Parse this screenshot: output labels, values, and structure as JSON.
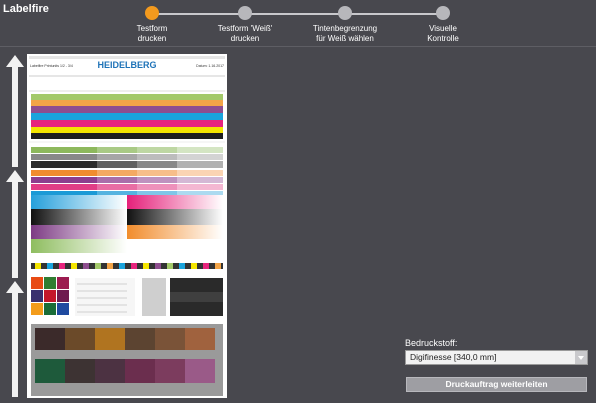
{
  "app": {
    "title": "Labelfire"
  },
  "stepper": {
    "steps": [
      {
        "label": "Testform\ndrucken",
        "state": "active"
      },
      {
        "label": "Testform 'Weiß'\ndrucken",
        "state": "inactive"
      },
      {
        "label": "Tintenbegrenzung\nfür Weiß wählen",
        "state": "inactive"
      },
      {
        "label": "Visuelle\nKontrolle",
        "state": "inactive"
      }
    ]
  },
  "preview": {
    "brand": "HEIDELBERG",
    "header_left": "Labelfire Printunits 1/2 - 3/4",
    "header_right": "Datum: 1.16.2017"
  },
  "controls": {
    "substrate_label": "Bedruckstoff:",
    "substrate_value": "Digifinesse [340,0 mm]",
    "submit_label": "Druckauftrag weiterleiten"
  },
  "colors": {
    "accent": "#f39a1e",
    "background": "#48484e",
    "inactive_step": "#b7b7bb"
  }
}
